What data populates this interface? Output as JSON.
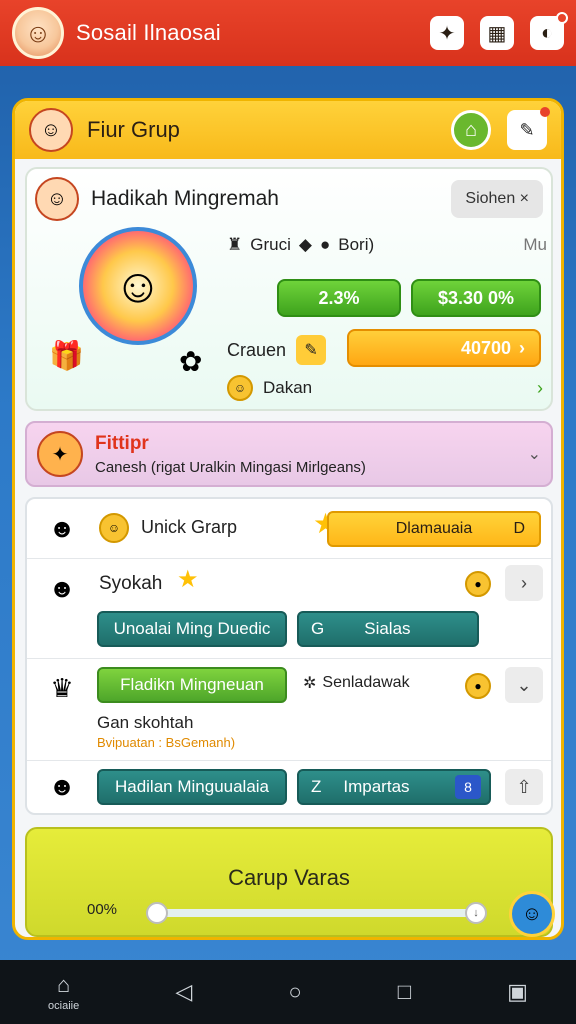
{
  "app": {
    "title": "Sosail Ilnaosai"
  },
  "top_icons": [
    {
      "icon": "puzzle-icon",
      "glyph": "✦"
    },
    {
      "icon": "calendar-icon",
      "glyph": "▦"
    },
    {
      "icon": "notification-icon",
      "glyph": "◐"
    }
  ],
  "panel": {
    "title": "Fiur Grup",
    "reward": {
      "title": "Hadikah Mingremah",
      "close_label": "Siohen ×",
      "row1": {
        "label1": "Gruci",
        "label2": "Bori)",
        "label3": "Mu"
      },
      "pill_percent": "2.3%",
      "pill_money": "$3.30 0%",
      "row3_label": "Crauen",
      "pill_orange": "40700",
      "row4_label": "Dakan"
    },
    "feature": {
      "title": "Fittipr",
      "subtitle": "Canesh (rigat Uralkin Mingasi Mirlgeans)"
    },
    "list": {
      "row1": {
        "label": "Unick Grarp",
        "banner": "Dlamauaia",
        "banner_suffix": "D"
      },
      "row2": {
        "label": "Syokah",
        "btn_a": "Unoalai Ming Duedic",
        "btn_b_prefix": "G",
        "btn_b": "Sialas"
      },
      "row3": {
        "btn_green": "Fladikn Mingneuan",
        "status": "Senladawak",
        "sub_label": "Gan skohtah",
        "sub_note": "Bvipuatan : BsGemanh)"
      },
      "row4": {
        "btn_a": "Hadilan Minguualaia",
        "btn_b_prefix": "Z",
        "btn_b": "Impartas",
        "btn_b_badge": "8"
      }
    },
    "bottom": {
      "title": "Carup Varas",
      "slider_label": "00%",
      "slider_value_fraction": 0.0
    }
  },
  "navbar": {
    "home_label": "ociaiie"
  }
}
